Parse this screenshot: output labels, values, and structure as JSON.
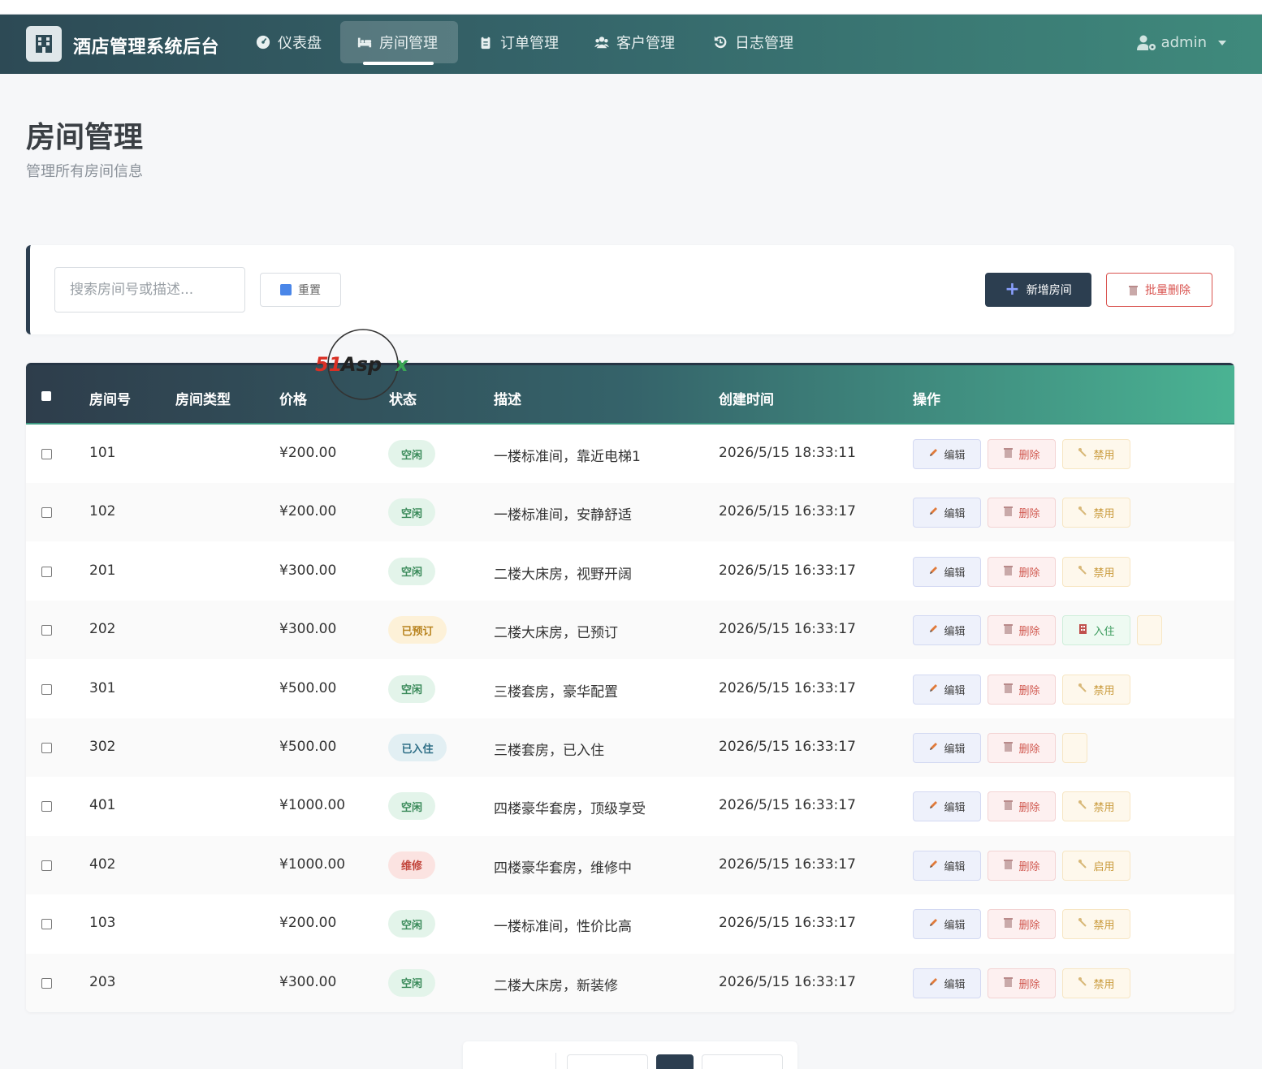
{
  "app": {
    "title": "酒店管理系统后台",
    "user": "admin"
  },
  "nav": [
    {
      "label": "仪表盘",
      "icon": "dashboard-icon"
    },
    {
      "label": "房间管理",
      "icon": "bed-icon",
      "active": true
    },
    {
      "label": "订单管理",
      "icon": "clipboard-icon"
    },
    {
      "label": "客户管理",
      "icon": "users-icon"
    },
    {
      "label": "日志管理",
      "icon": "history-icon"
    }
  ],
  "page": {
    "title": "房间管理",
    "subtitle": "管理所有房间信息"
  },
  "toolbar": {
    "search_placeholder": "搜索房间号或描述...",
    "reset_label": "重置",
    "add_label": "新增房间",
    "batch_delete_label": "批量删除"
  },
  "table": {
    "headers": {
      "room_no": "房间号",
      "room_type": "房间类型",
      "price": "价格",
      "status": "状态",
      "desc": "描述",
      "created": "创建时间",
      "actions": "操作"
    },
    "action_labels": {
      "edit": "编辑",
      "delete": "删除",
      "disable": "禁用",
      "enable": "启用",
      "checkin": "入住"
    },
    "rows": [
      {
        "room_no": "101",
        "room_type": "",
        "price": "¥200.00",
        "status": "空闲",
        "desc": "一楼标准间，靠近电梯1",
        "created": "2026/5/15 18:33:11"
      },
      {
        "room_no": "102",
        "room_type": "",
        "price": "¥200.00",
        "status": "空闲",
        "desc": "一楼标准间，安静舒适",
        "created": "2026/5/15 16:33:17"
      },
      {
        "room_no": "201",
        "room_type": "",
        "price": "¥300.00",
        "status": "空闲",
        "desc": "二楼大床房，视野开阔",
        "created": "2026/5/15 16:33:17"
      },
      {
        "room_no": "202",
        "room_type": "",
        "price": "¥300.00",
        "status": "已预订",
        "desc": "二楼大床房，已预订",
        "created": "2026/5/15 16:33:17"
      },
      {
        "room_no": "301",
        "room_type": "",
        "price": "¥500.00",
        "status": "空闲",
        "desc": "三楼套房，豪华配置",
        "created": "2026/5/15 16:33:17"
      },
      {
        "room_no": "302",
        "room_type": "",
        "price": "¥500.00",
        "status": "已入住",
        "desc": "三楼套房，已入住",
        "created": "2026/5/15 16:33:17"
      },
      {
        "room_no": "401",
        "room_type": "",
        "price": "¥1000.00",
        "status": "空闲",
        "desc": "四楼豪华套房，顶级享受",
        "created": "2026/5/15 16:33:17"
      },
      {
        "room_no": "402",
        "room_type": "",
        "price": "¥1000.00",
        "status": "维修",
        "desc": "四楼豪华套房，维修中",
        "created": "2026/5/15 16:33:17"
      },
      {
        "room_no": "103",
        "room_type": "",
        "price": "¥200.00",
        "status": "空闲",
        "desc": "一楼标准间，性价比高",
        "created": "2026/5/15 16:33:17"
      },
      {
        "room_no": "203",
        "room_type": "",
        "price": "¥300.00",
        "status": "空闲",
        "desc": "二楼大床房，新装修",
        "created": "2026/5/15 16:33:17"
      }
    ]
  },
  "watermark": {
    "text": "51Aspx"
  },
  "colors": {
    "primary": "#2c3e50",
    "accent": "#4ab393",
    "danger": "#d9534f",
    "warning": "#c99a3b",
    "success": "#3a9a5c"
  }
}
